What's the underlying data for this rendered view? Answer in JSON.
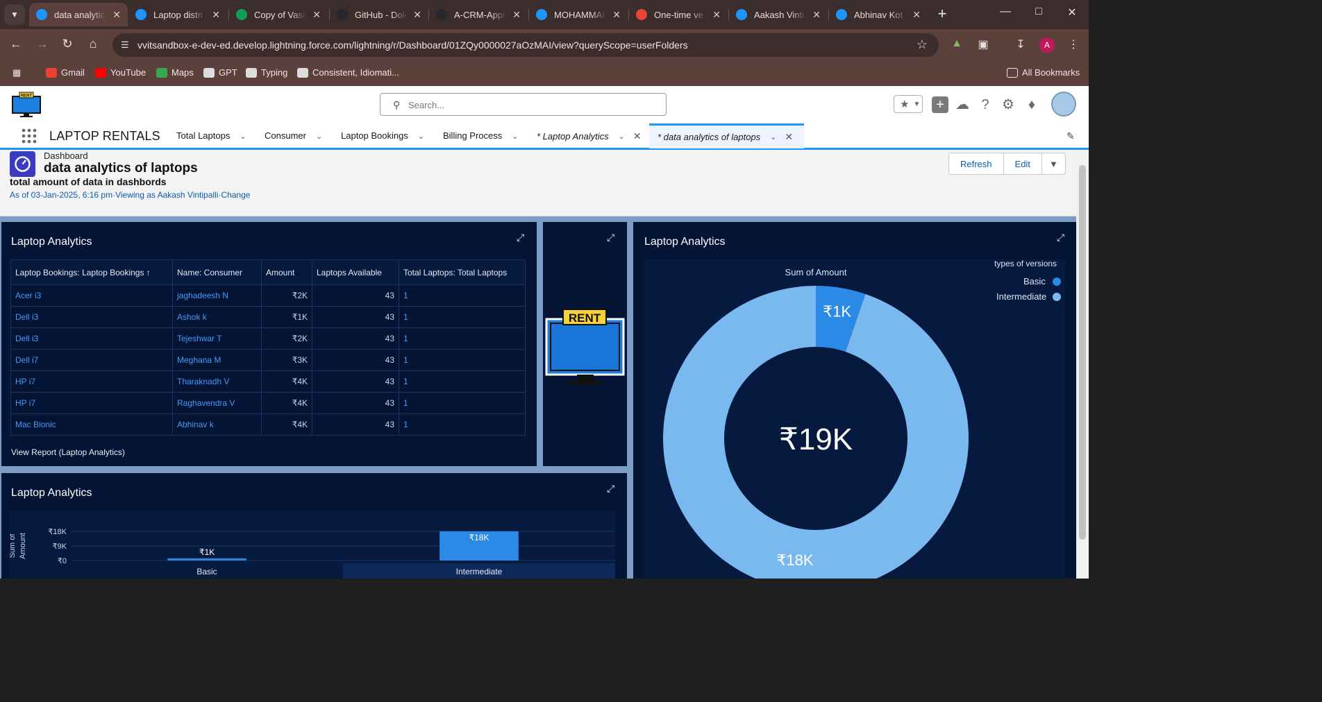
{
  "browser": {
    "tabs": [
      {
        "title": "data analytic",
        "color": "#1b96ff",
        "active": true
      },
      {
        "title": "Laptop distri",
        "color": "#1b96ff"
      },
      {
        "title": "Copy of Vasir",
        "color": "#0f9d58"
      },
      {
        "title": "GitHub - Dok",
        "color": "#24292f"
      },
      {
        "title": "A-CRM-Appl",
        "color": "#24292f"
      },
      {
        "title": "MOHAMMAI",
        "color": "#1b96ff"
      },
      {
        "title": "One-time ve",
        "color": "#ea4335"
      },
      {
        "title": "Aakash Vinti",
        "color": "#1b96ff"
      },
      {
        "title": "Abhinav Kot",
        "color": "#1b96ff"
      }
    ],
    "url": "vvitsandbox-e-dev-ed.develop.lightning.force.com/lightning/r/Dashboard/01ZQy0000027aOzMAI/view?queryScope=userFolders",
    "profile_initial": "A",
    "bookmarks": [
      {
        "label": "Gmail",
        "color": "#ea4335"
      },
      {
        "label": "YouTube",
        "color": "#ff0000"
      },
      {
        "label": "Maps",
        "color": "#34a853"
      },
      {
        "label": "GPT",
        "color": "#dddddd"
      },
      {
        "label": "Typing",
        "color": "#dddddd"
      },
      {
        "label": "Consistent, Idiomati...",
        "color": "#dddddd"
      }
    ],
    "all_bookmarks": "All Bookmarks"
  },
  "sf": {
    "logo_text": "RENT",
    "search_placeholder": "Search...",
    "app_name": "LAPTOP RENTALS",
    "nav_items": [
      "Total Laptops",
      "Consumer",
      "Laptop Bookings",
      "Billing Process"
    ],
    "nav_tabs": [
      "* Laptop Analytics",
      "* data analytics of laptops"
    ]
  },
  "dashboard": {
    "kicker": "Dashboard",
    "title": "data analytics of laptops",
    "subtitle": "total amount of data in dashbords",
    "meta": "As of 03-Jan-2025, 6:16 pm·Viewing as Aakash Vintipalli·Change",
    "buttons": {
      "refresh": "Refresh",
      "edit": "Edit"
    }
  },
  "table_panel": {
    "title": "Laptop Analytics",
    "columns": [
      "Laptop Bookings: Laptop Bookings ↑",
      "Name: Consumer",
      "Amount",
      "Laptops Available",
      "Total Laptops: Total Laptops"
    ],
    "rows": [
      [
        "Acer i3",
        "jaghadeesh N",
        "₹2K",
        "43",
        "1"
      ],
      [
        "Dell i3",
        "Ashok k",
        "₹1K",
        "43",
        "1"
      ],
      [
        "Dell i3",
        "Tejeshwar T",
        "₹2K",
        "43",
        "1"
      ],
      [
        "Dell i7",
        "Meghana M",
        "₹3K",
        "43",
        "1"
      ],
      [
        "HP i7",
        "Tharaknadh V",
        "₹4K",
        "43",
        "1"
      ],
      [
        "HP i7",
        "Raghavendra V",
        "₹4K",
        "43",
        "1"
      ],
      [
        "Mac Bionic",
        "Abhinav k",
        "₹4K",
        "43",
        "1"
      ]
    ],
    "view_report": "View Report (Laptop Analytics)"
  },
  "image_panel": {
    "sign_text": "RENT"
  },
  "bar_panel": {
    "title": "Laptop Analytics"
  },
  "donut_panel": {
    "title": "Laptop Analytics",
    "center_label": "₹19K",
    "legend_title": "types of versions"
  },
  "chart_data": [
    {
      "type": "bar",
      "title": "",
      "ylabel": "Sum of Amount",
      "categories": [
        "Basic",
        "Intermediate"
      ],
      "values": [
        1000,
        18000
      ],
      "data_labels": [
        "₹1K",
        "₹18K"
      ],
      "yticks": [
        "₹18K",
        "₹9K",
        "₹0"
      ],
      "ylim": [
        0,
        18000
      ],
      "color": "#2a8ae6",
      "highlight_category": "Intermediate"
    },
    {
      "type": "pie",
      "variant": "donut",
      "title": "Sum of Amount",
      "labels": [
        "Basic",
        "Intermediate"
      ],
      "values": [
        1000,
        18000
      ],
      "data_labels": [
        "₹1K",
        "₹18K"
      ],
      "colors": [
        "#2a8ae6",
        "#7ab8f0"
      ],
      "total_label": "₹19K",
      "legend_title": "types of versions",
      "legend_position": "top-right"
    }
  ]
}
